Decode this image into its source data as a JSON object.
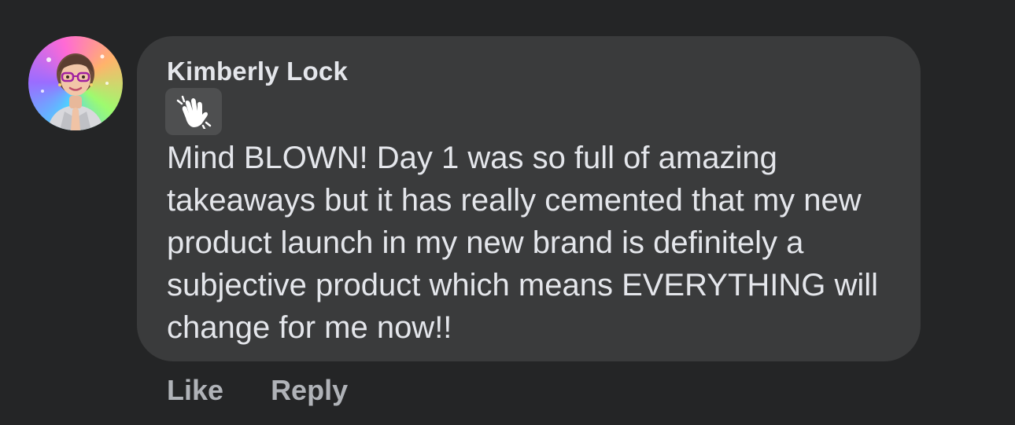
{
  "comment": {
    "author": "Kimberly Lock",
    "badge_icon": "waving-hand-icon",
    "text": "Mind BLOWN! Day 1 was so full of amazing takeaways but it has really cemented that my new product launch in my new brand is definitely a subjective product which means EVERYTHING will change for me now!!",
    "actions": {
      "like_label": "Like",
      "reply_label": "Reply"
    }
  },
  "colors": {
    "background": "#242526",
    "bubble": "#3a3b3c",
    "badge": "#4e4f50",
    "primary_text": "#e4e6eb",
    "secondary_text": "#b0b3b8"
  }
}
